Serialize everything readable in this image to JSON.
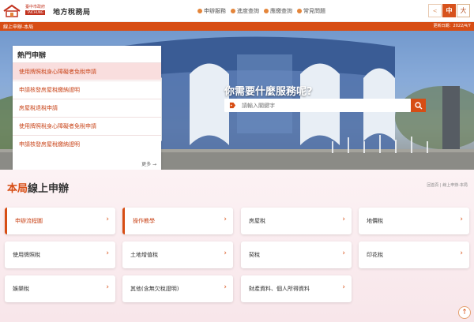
{
  "header": {
    "logo_small": "臺中市政府",
    "logo_en": "TAICHUNG",
    "logo_main": "地方稅務局",
    "nav": [
      {
        "label": "申辦服務"
      },
      {
        "label": "進度查詢"
      },
      {
        "label": "應繳查詢"
      },
      {
        "label": "常見問題"
      }
    ],
    "font_buttons": {
      "prev": "<",
      "medium": "中",
      "large": "大"
    }
  },
  "crumb_bar": {
    "left": "線上申辦-本局",
    "right": "更新日期：2022/4/7"
  },
  "hero": {
    "search_title": "你需要什麼服務呢?",
    "search_placeholder": "請輸入關鍵字"
  },
  "hot": {
    "title": "熱門申辦",
    "items": [
      {
        "label": "使用牌照稅身心障礙者免稅申請"
      },
      {
        "label": "申請核發房屋稅繳納證明"
      },
      {
        "label": "房屋稅退稅申請"
      },
      {
        "label": "使用牌照稅身心障礙者免稅申請"
      },
      {
        "label": "申請核發房屋稅繳納證明"
      }
    ],
    "more": "更多 →"
  },
  "section": {
    "title_accent": "本局",
    "title_rest": "線上申辦",
    "breadcrumb": "回首頁 | 線上申辦-本局"
  },
  "cards": [
    {
      "label": "申辦流程圖",
      "chev": "›"
    },
    {
      "label": "操作教學",
      "chev": "›"
    },
    {
      "label": "房屋稅",
      "chev": "›"
    },
    {
      "label": "地價稅",
      "chev": "›"
    },
    {
      "label": "使用牌照稅",
      "chev": "›"
    },
    {
      "label": "土地增值稅",
      "chev": "›"
    },
    {
      "label": "契稅",
      "chev": "›"
    },
    {
      "label": "印花稅",
      "chev": "›"
    },
    {
      "label": "娛樂稅",
      "chev": "›"
    },
    {
      "label": "其他(含無欠稅證明)",
      "chev": "›"
    },
    {
      "label": "財產資料、個人所得資料",
      "chev": "›"
    }
  ],
  "back_to_top": "↑",
  "colors": {
    "accent": "#d74d14",
    "accent_light": "#f9dede",
    "bg": "#fbeef1"
  }
}
